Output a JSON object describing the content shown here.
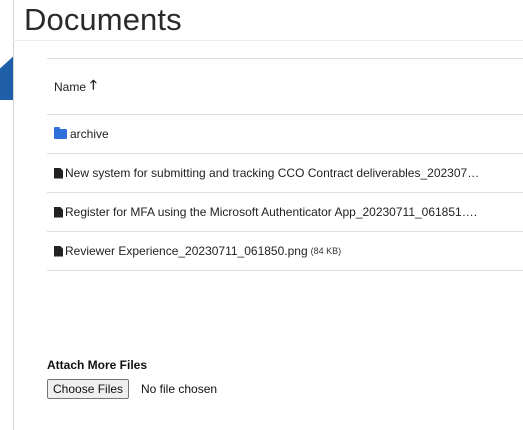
{
  "page": {
    "title": "Documents"
  },
  "table": {
    "header": {
      "name_label": "Name",
      "sort_icon": "arrow-up-icon"
    },
    "rows": [
      {
        "icon": "folder-icon",
        "name": "archive",
        "size": ""
      },
      {
        "icon": "file-icon",
        "name": "New system for submitting and tracking CCO Contract deliverables_202307…",
        "size": ""
      },
      {
        "icon": "file-icon",
        "name": "Register for MFA using the Microsoft Authenticator App_20230711_061851….",
        "size": ""
      },
      {
        "icon": "file-icon",
        "name": "Reviewer Experience_20230711_061850.png",
        "size": "(84 KB)"
      }
    ]
  },
  "attach": {
    "title": "Attach More Files",
    "button_label": "Choose Files",
    "status": "No file chosen"
  },
  "colors": {
    "accent": "#1f5fa8",
    "folder": "#2e6fd9"
  }
}
